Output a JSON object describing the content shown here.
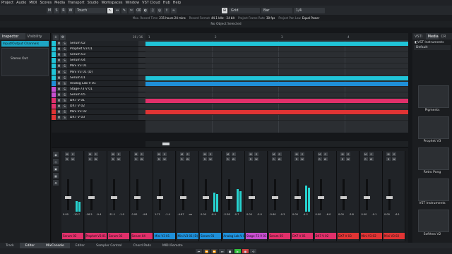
{
  "menu": [
    "Project",
    "Audio",
    "MIDI",
    "Scores",
    "Media",
    "Transport",
    "Studio",
    "Workspaces",
    "Window",
    "VST Cloud",
    "Hub",
    "Help"
  ],
  "toolbar": {
    "buttons": [
      "M",
      "S",
      "R",
      "W"
    ],
    "automation_mode": "Touch",
    "tools": [
      "↖",
      "↔",
      "✎",
      "✂",
      "⌫",
      "◐",
      "♫",
      "◎",
      "⇧",
      "≈"
    ],
    "snap_label": "Grid",
    "snap_value": "Bar",
    "quantize": "1/4"
  },
  "status": [
    {
      "label": "Max. Record Time",
      "value": "215 hours 24 mins"
    },
    {
      "label": "Record Format",
      "value": "44.1 kHz - 24 bit"
    },
    {
      "label": "Project Frame Rate",
      "value": "30 fps"
    },
    {
      "label": "Project Pan Law",
      "value": "Equal Power"
    }
  ],
  "info_line": "No Object Selected",
  "inspector": {
    "tabs": [
      "Inspector",
      "Visibility"
    ],
    "section": "Input/Output Channels",
    "output": "Stereo Out"
  },
  "track_header": {
    "counter": "16 / 16"
  },
  "ruler": {
    "marks": [
      "1",
      "2",
      "3",
      "4"
    ]
  },
  "tracks": [
    {
      "name": "Serum 02",
      "color": "#20c4d8"
    },
    {
      "name": "Prophet V3 01",
      "color": "#20c4d8"
    },
    {
      "name": "Serum 03",
      "color": "#20c4d8"
    },
    {
      "name": "Serum 04",
      "color": "#20c4d8"
    },
    {
      "name": "Mini V3 01",
      "color": "#20c4d8"
    },
    {
      "name": "Mini V3 01 (D)",
      "color": "#20c4d8"
    },
    {
      "name": "Serum 01",
      "color": "#20c4d8"
    },
    {
      "name": "Analog Lab V 01",
      "color": "#1f8fd8"
    },
    {
      "name": "Stage-73 V 01",
      "color": "#c84fd0"
    },
    {
      "name": "Serum 05",
      "color": "#c84fd0"
    },
    {
      "name": "DX7 V 01",
      "color": "#e0306a"
    },
    {
      "name": "DX7 V 02",
      "color": "#e0306a"
    },
    {
      "name": "Mini V3 02",
      "color": "#e03434"
    },
    {
      "name": "DX7 V 03",
      "color": "#e03434"
    }
  ],
  "track_controls": {
    "mute": "M",
    "solo": "S"
  },
  "mixer": {
    "left_buttons": [
      "◉",
      "◇",
      "▣",
      "▦",
      "⚙"
    ],
    "channels": [
      {
        "name": "Serum 02",
        "color": "#e0306a",
        "vol": "0.00",
        "pan": "-10.7",
        "meter": 0.35
      },
      {
        "name": "Prophet V3 01",
        "color": "#e0306a",
        "vol": "-16.5",
        "pan": "-9.4",
        "meter": 0
      },
      {
        "name": "Serum 03",
        "color": "#e0306a",
        "vol": "-31.1",
        "pan": "-1.0",
        "meter": 0
      },
      {
        "name": "Serum 04",
        "color": "#e0306a",
        "vol": "0.00",
        "pan": "-4.8",
        "meter": 0
      },
      {
        "name": "Mini V3 01",
        "color": "#1f8fd8",
        "vol": "1.71",
        "pan": "-1.4",
        "meter": 0
      },
      {
        "name": "Mini V3 01 (D)",
        "color": "#1f8fd8",
        "vol": "-4.87",
        "pan": "-oo",
        "meter": 0
      },
      {
        "name": "Serum 01",
        "color": "#1f8fd8",
        "vol": "0.00",
        "pan": "-8.0",
        "meter": 0.62
      },
      {
        "name": "Analog Lab V 01",
        "color": "#1f8fd8",
        "vol": "-2.26",
        "pan": "-0.7",
        "meter": 0.72
      },
      {
        "name": "Stage-73 V 01",
        "color": "#c84fd0",
        "vol": "0.00",
        "pan": "-5.0",
        "meter": 0
      },
      {
        "name": "Serum 05",
        "color": "#e0306a",
        "vol": "-5.60",
        "pan": "-0.3",
        "meter": 0
      },
      {
        "name": "DX7 V 01",
        "color": "#e0306a",
        "vol": "0.00",
        "pan": "-4.2",
        "meter": 0.85
      },
      {
        "name": "DX7 V 02",
        "color": "#e0306a",
        "vol": "0.00",
        "pan": "-6.0",
        "meter": 0
      },
      {
        "name": "DX7 V 03",
        "color": "#e03434",
        "vol": "0.00",
        "pan": "-3.8",
        "meter": 0
      },
      {
        "name": "Mini V3 02",
        "color": "#e03434",
        "vol": "0.00",
        "pan": "-0.1",
        "meter": 0
      },
      {
        "name": "Mini V3 02",
        "color": "#e03434",
        "vol": "0.00",
        "pan": "-6.1",
        "meter": 0
      }
    ]
  },
  "right_panel": {
    "tabs": [
      "VSTi",
      "Media",
      "CR"
    ],
    "breadcrumb": "VST Instruments",
    "preset": "Default",
    "items": [
      "Pigments",
      "Prophet V3",
      "Retro Pong",
      "VST Instruments",
      "Softhea V2"
    ]
  },
  "bottom_tabs": [
    "Track",
    "Editor",
    "MixConsole",
    "Editor",
    "Sampler Control",
    "Chord Pads",
    "MIDI Remote"
  ],
  "transport": [
    "⏮",
    "⏪",
    "⏩",
    "⏭",
    "■",
    "▶",
    "●",
    "⟲"
  ]
}
